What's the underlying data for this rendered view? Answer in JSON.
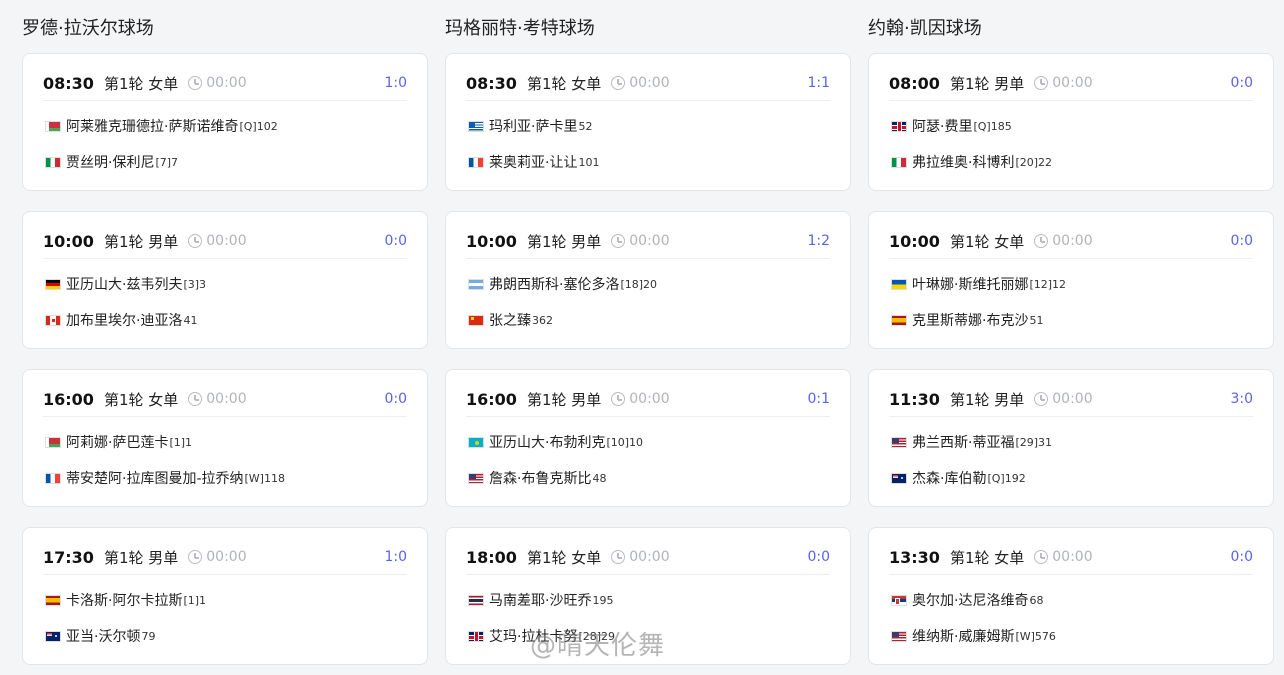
{
  "courts": [
    {
      "name": "罗德·拉沃尔球场",
      "matches": [
        {
          "time": "08:30",
          "round": "第1轮 女单",
          "duration": "00:00",
          "score": "1:0",
          "p1": {
            "name": "阿莱雅克珊德拉·萨斯诺维奇",
            "seed": "[Q]102",
            "flag": "flag-by"
          },
          "p2": {
            "name": "贾丝明·保利尼",
            "seed": "[7]7",
            "flag": "flag-it"
          }
        },
        {
          "time": "10:00",
          "round": "第1轮 男单",
          "duration": "00:00",
          "score": "0:0",
          "p1": {
            "name": "亚历山大·兹韦列夫",
            "seed": "[3]3",
            "flag": "flag-de"
          },
          "p2": {
            "name": "加布里埃尔·迪亚洛",
            "seed": "41",
            "flag": "flag-ca"
          }
        },
        {
          "time": "16:00",
          "round": "第1轮 女单",
          "duration": "00:00",
          "score": "0:0",
          "p1": {
            "name": "阿莉娜·萨巴莲卡",
            "seed": "[1]1",
            "flag": "flag-by"
          },
          "p2": {
            "name": "蒂安楚阿·拉库图曼加-拉乔纳",
            "seed": "[W]118",
            "flag": "flag-fr"
          }
        },
        {
          "time": "17:30",
          "round": "第1轮 男单",
          "duration": "00:00",
          "score": "1:0",
          "p1": {
            "name": "卡洛斯·阿尔卡拉斯",
            "seed": "[1]1",
            "flag": "flag-es"
          },
          "p2": {
            "name": "亚当·沃尔顿",
            "seed": "79",
            "flag": "flag-au"
          }
        }
      ]
    },
    {
      "name": "玛格丽特·考特球场",
      "matches": [
        {
          "time": "08:30",
          "round": "第1轮 女单",
          "duration": "00:00",
          "score": "1:1",
          "p1": {
            "name": "玛利亚·萨卡里",
            "seed": "52",
            "flag": "flag-gr"
          },
          "p2": {
            "name": "莱奥莉亚·让让",
            "seed": "101",
            "flag": "flag-fr"
          }
        },
        {
          "time": "10:00",
          "round": "第1轮 男单",
          "duration": "00:00",
          "score": "1:2",
          "p1": {
            "name": "弗朗西斯科·塞伦多洛",
            "seed": "[18]20",
            "flag": "flag-ar"
          },
          "p2": {
            "name": "张之臻",
            "seed": "362",
            "flag": "flag-cn"
          }
        },
        {
          "time": "16:00",
          "round": "第1轮 男单",
          "duration": "00:00",
          "score": "0:1",
          "p1": {
            "name": "亚历山大·布勃利克",
            "seed": "[10]10",
            "flag": "flag-kz"
          },
          "p2": {
            "name": "詹森·布鲁克斯比",
            "seed": "48",
            "flag": "flag-us"
          }
        },
        {
          "time": "18:00",
          "round": "第1轮 女单",
          "duration": "00:00",
          "score": "0:0",
          "p1": {
            "name": "马南差耶·沙旺乔",
            "seed": "195",
            "flag": "flag-th"
          },
          "p2": {
            "name": "艾玛·拉杜卡努",
            "seed": "[28]29",
            "flag": "flag-gb"
          }
        }
      ]
    },
    {
      "name": "约翰·凯因球场",
      "matches": [
        {
          "time": "08:00",
          "round": "第1轮 男单",
          "duration": "00:00",
          "score": "0:0",
          "p1": {
            "name": "阿瑟·费里",
            "seed": "[Q]185",
            "flag": "flag-gb"
          },
          "p2": {
            "name": "弗拉维奥·科博利",
            "seed": "[20]22",
            "flag": "flag-it"
          }
        },
        {
          "time": "10:00",
          "round": "第1轮 女单",
          "duration": "00:00",
          "score": "0:0",
          "p1": {
            "name": "叶琳娜·斯维托丽娜",
            "seed": "[12]12",
            "flag": "flag-ua"
          },
          "p2": {
            "name": "克里斯蒂娜·布克沙",
            "seed": "51",
            "flag": "flag-es"
          }
        },
        {
          "time": "11:30",
          "round": "第1轮 男单",
          "duration": "00:00",
          "score": "3:0",
          "p1": {
            "name": "弗兰西斯·蒂亚福",
            "seed": "[29]31",
            "flag": "flag-us"
          },
          "p2": {
            "name": "杰森·库伯勒",
            "seed": "[Q]192",
            "flag": "flag-au"
          }
        },
        {
          "time": "13:30",
          "round": "第1轮 女单",
          "duration": "00:00",
          "score": "0:0",
          "p1": {
            "name": "奥尔加·达尼洛维奇",
            "seed": "68",
            "flag": "flag-rs"
          },
          "p2": {
            "name": "维纳斯·威廉姆斯",
            "seed": "[W]576",
            "flag": "flag-us"
          }
        }
      ]
    }
  ],
  "watermark": "@晴天伦舞"
}
